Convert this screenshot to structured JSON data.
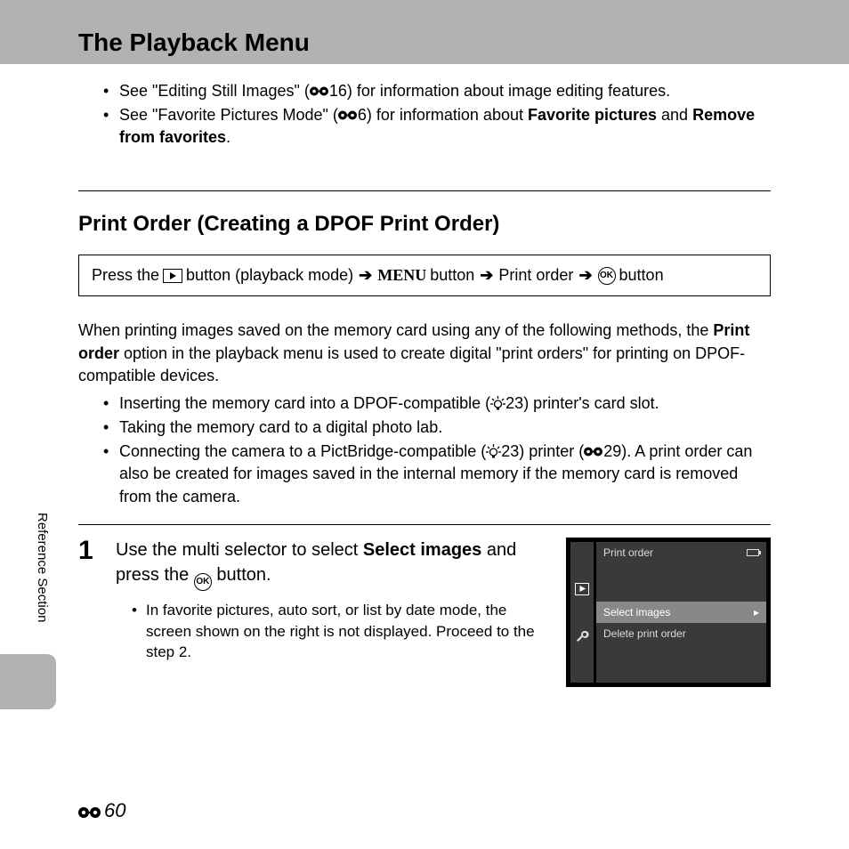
{
  "title": "The Playback Menu",
  "notes": {
    "n1_a": "See \"Editing Still Images\" (",
    "n1_ref": "16",
    "n1_b": ") for information about image editing features.",
    "n2_a": "See \"Favorite Pictures Mode\" (",
    "n2_ref": "6",
    "n2_b": ") for information about ",
    "n2_bold1": "Favorite pictures",
    "n2_c": " and ",
    "n2_bold2": "Remove from favorites",
    "n2_d": "."
  },
  "section_heading": "Print Order (Creating a DPOF Print Order)",
  "nav": {
    "a": "Press the ",
    "b": " button (playback mode) ",
    "menu": "MENU",
    "c": " button ",
    "d": " Print order ",
    "e": " button"
  },
  "intro": {
    "p1_a": "When printing images saved on the memory card using any of the following methods, the ",
    "p1_bold": "Print order",
    "p1_b": " option in the playback menu is used to create digital \"print orders\" for printing on DPOF-compatible devices.",
    "b1_a": "Inserting the memory card into a DPOF-compatible (",
    "b1_ref": "23",
    "b1_b": ") printer's card slot.",
    "b2": "Taking the memory card to a digital photo lab.",
    "b3_a": "Connecting the camera to a PictBridge-compatible (",
    "b3_ref1": "23",
    "b3_b": ") printer (",
    "b3_ref2": "29",
    "b3_c": "). A print order can also be created for images saved in the internal memory if the memory card is removed from the camera."
  },
  "step": {
    "num": "1",
    "line1_a": "Use the multi selector to select ",
    "line1_bold": "Select images",
    "line1_b": " and press the ",
    "line1_c": " button.",
    "sub": "In favorite pictures, auto sort, or list by date mode, the screen shown on the right is not displayed. Proceed to the step 2."
  },
  "screen": {
    "title": "Print order",
    "item1": "Select images",
    "item2": "Delete print order"
  },
  "side_label": "Reference Section",
  "page_number": "60"
}
